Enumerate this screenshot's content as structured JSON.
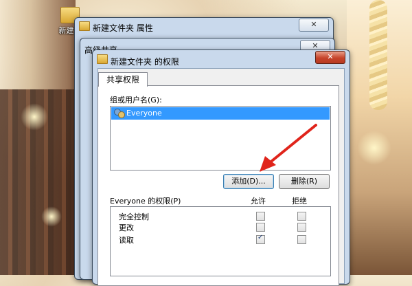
{
  "desktop": {
    "icon_label": "新建文"
  },
  "windows": {
    "properties": {
      "title": "新建文件夹 属性",
      "close": "✕"
    },
    "advanced_sharing": {
      "title": "高级共享",
      "close": "✕"
    },
    "permissions": {
      "title": "新建文件夹 的权限",
      "close": "✕",
      "tab": "共享权限",
      "group_label": "组或用户名(G):",
      "users": [
        "Everyone"
      ],
      "add_button": "添加(D)...",
      "remove_button": "删除(R)",
      "perm_label": "Everyone 的权限(P)",
      "col_allow": "允许",
      "col_deny": "拒绝",
      "permissions": [
        {
          "name": "完全控制",
          "allow": false,
          "deny": false
        },
        {
          "name": "更改",
          "allow": false,
          "deny": false
        },
        {
          "name": "读取",
          "allow": true,
          "deny": false
        }
      ]
    }
  },
  "annotation": {
    "arrow_color": "#e0241b"
  }
}
